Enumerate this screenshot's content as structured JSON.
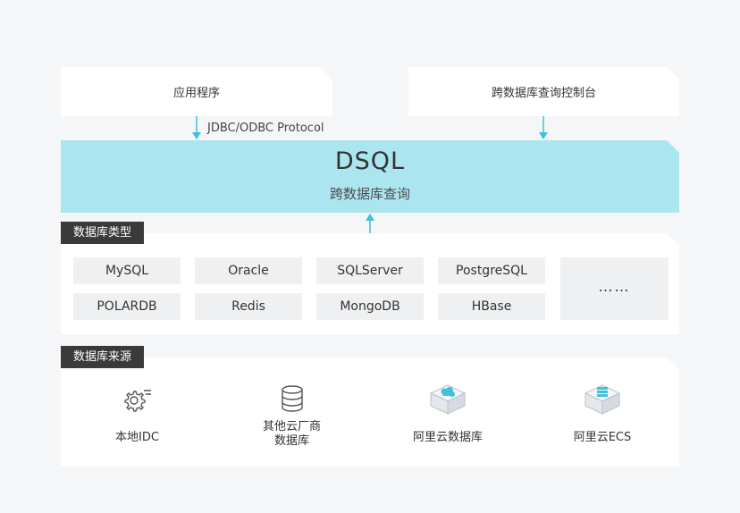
{
  "top": {
    "app_label": "应用程序",
    "console_label": "跨数据库查询控制台"
  },
  "protocol_label": "JDBC/ODBC Protocol",
  "dsql": {
    "title": "DSQL",
    "subtitle": "跨数据库查询"
  },
  "types": {
    "tag": "数据库类型",
    "items": [
      "MySQL",
      "Oracle",
      "SQLServer",
      "PostgreSQL",
      "POLARDB",
      "Redis",
      "MongoDB",
      "HBase"
    ],
    "more": "……"
  },
  "sources": {
    "tag": "数据库来源",
    "items": [
      {
        "label": "本地IDC",
        "icon": "gears-icon"
      },
      {
        "label_line1": "其他云厂商",
        "label_line2": "数据库",
        "icon": "database-icon"
      },
      {
        "label": "阿里云数据库",
        "icon": "cloud-database-cube-icon"
      },
      {
        "label": "阿里云ECS",
        "icon": "server-cube-icon"
      }
    ]
  },
  "colors": {
    "accent": "#3fc1d9",
    "band": "#abe5f0",
    "tag_bg": "#3a3a3a",
    "item_bg": "#eef0f2"
  }
}
